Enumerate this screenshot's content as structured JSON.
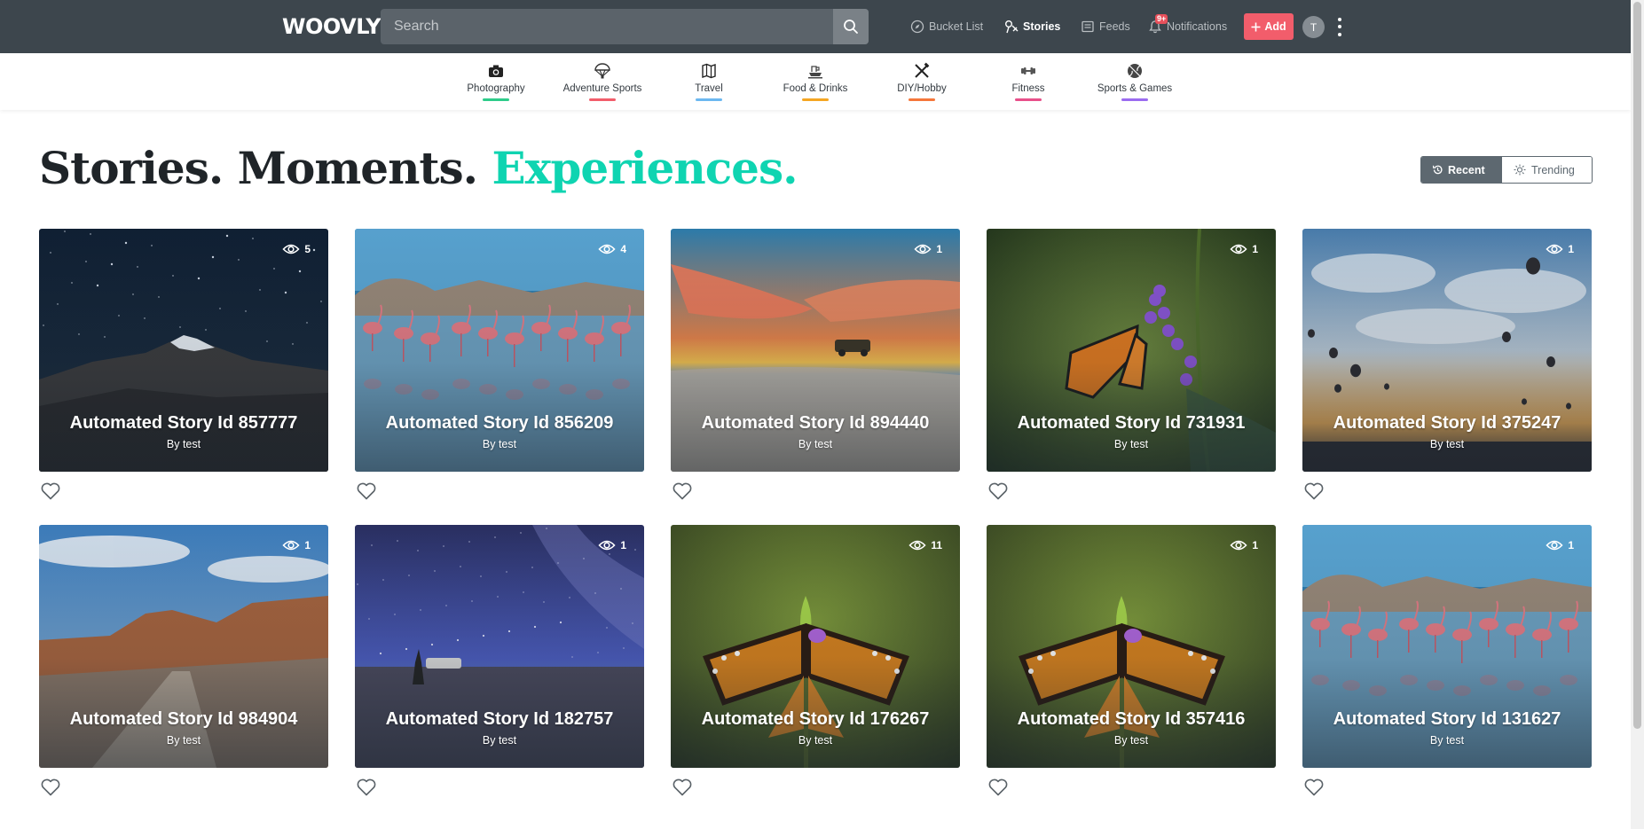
{
  "header": {
    "logo": "WOOVLY",
    "search_placeholder": "Search",
    "nav": {
      "bucket_list": "Bucket List",
      "stories": "Stories",
      "feeds": "Feeds",
      "notifications": "Notifications",
      "notifications_badge": "9+"
    },
    "add_label": "Add",
    "avatar_initial": "T"
  },
  "categories": [
    {
      "label": "Photography",
      "icon": "camera-icon",
      "color": "#2ecc8a"
    },
    {
      "label": "Adventure Sports",
      "icon": "parachute-icon",
      "color": "#f25d6b"
    },
    {
      "label": "Travel",
      "icon": "map-icon",
      "color": "#6cb8f0"
    },
    {
      "label": "Food & Drinks",
      "icon": "food-icon",
      "color": "#f5a623"
    },
    {
      "label": "DIY/Hobby",
      "icon": "tools-icon",
      "color": "#f5773b"
    },
    {
      "label": "Fitness",
      "icon": "dumbbell-icon",
      "color": "#e8508a"
    },
    {
      "label": "Sports & Games",
      "icon": "ball-icon",
      "color": "#9b6cf0"
    }
  ],
  "headline": {
    "part1": "Stories. Moments. ",
    "part2": "Experiences."
  },
  "sort": {
    "recent": "Recent",
    "trending": "Trending"
  },
  "stories": [
    {
      "title": "Automated Story Id 857777",
      "author": "By test",
      "views": "5",
      "scene": "night-mountain"
    },
    {
      "title": "Automated Story Id 856209",
      "author": "By test",
      "views": "4",
      "scene": "flamingos"
    },
    {
      "title": "Automated Story Id 894440",
      "author": "By test",
      "views": "1",
      "scene": "sunset-salt-flat"
    },
    {
      "title": "Automated Story Id 731931",
      "author": "By test",
      "views": "1",
      "scene": "monarch-butterfly"
    },
    {
      "title": "Automated Story Id 375247",
      "author": "By test",
      "views": "1",
      "scene": "balloons-sky"
    },
    {
      "title": "Automated Story Id 984904",
      "author": "By test",
      "views": "1",
      "scene": "canyon-road"
    },
    {
      "title": "Automated Story Id 182757",
      "author": "By test",
      "views": "1",
      "scene": "milky-way"
    },
    {
      "title": "Automated Story Id 176267",
      "author": "By test",
      "views": "11",
      "scene": "tiger-butterfly"
    },
    {
      "title": "Automated Story Id 357416",
      "author": "By test",
      "views": "1",
      "scene": "tiger-butterfly"
    },
    {
      "title": "Automated Story Id 131627",
      "author": "By test",
      "views": "1",
      "scene": "flamingos"
    }
  ],
  "colors": {
    "topbar": "#3d464d",
    "accent": "#0fd4b1",
    "add_button": "#f25d6b"
  }
}
